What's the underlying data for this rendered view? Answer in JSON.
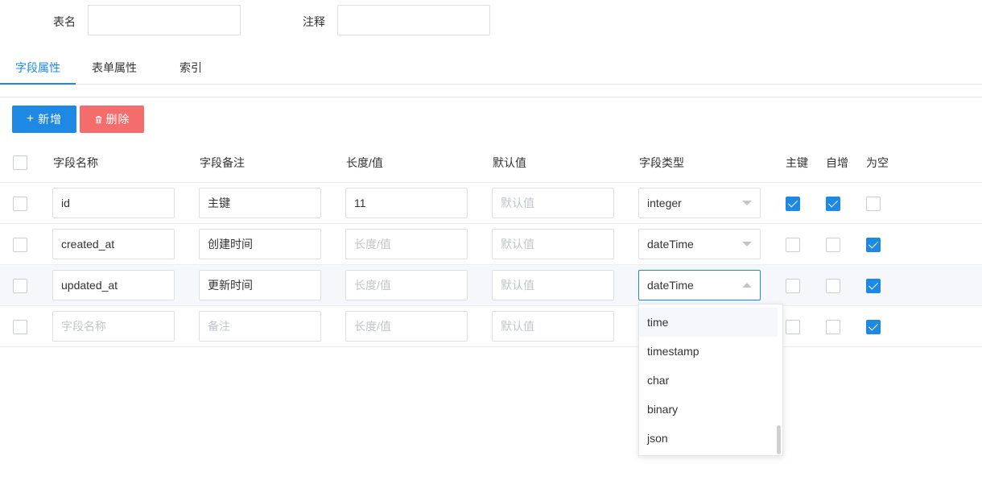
{
  "form": {
    "table_name_label": "表名",
    "table_name_value": "",
    "comment_label": "注释",
    "comment_value": ""
  },
  "tabs": [
    {
      "label": "字段属性",
      "active": true
    },
    {
      "label": "表单属性",
      "active": false
    },
    {
      "label": "索引",
      "active": false
    }
  ],
  "toolbar": {
    "add_label": "新增",
    "add_icon": "plus-icon",
    "delete_label": "删除",
    "delete_icon": "trash-icon"
  },
  "columns": {
    "name": "字段名称",
    "comment": "字段备注",
    "length": "长度/值",
    "default": "默认值",
    "type": "字段类型",
    "primary": "主键",
    "autoinc": "自增",
    "nullable": "为空"
  },
  "placeholders": {
    "name": "字段名称",
    "comment": "备注",
    "length": "长度/值",
    "default": "默认值"
  },
  "rows": [
    {
      "name": "id",
      "comment": "主键",
      "length": "11",
      "default": "",
      "type": "integer",
      "primary": true,
      "autoinc": true,
      "nullable": false
    },
    {
      "name": "created_at",
      "comment": "创建时间",
      "length": "",
      "default": "",
      "type": "dateTime",
      "primary": false,
      "autoinc": false,
      "nullable": true
    },
    {
      "name": "updated_at",
      "comment": "更新时间",
      "length": "",
      "default": "",
      "type": "dateTime",
      "primary": false,
      "autoinc": false,
      "nullable": true
    },
    {
      "name": "",
      "comment": "",
      "length": "",
      "default": "",
      "type": "",
      "primary": false,
      "autoinc": false,
      "nullable": true
    }
  ],
  "type_dropdown": {
    "open_on_row": 2,
    "options": [
      "time",
      "timestamp",
      "char",
      "binary",
      "json"
    ],
    "highlighted": "time"
  },
  "colors": {
    "accent": "#1e88e5",
    "danger": "#f56c6c",
    "placeholder": "#c0c4cc",
    "border": "#dcdfe6"
  }
}
